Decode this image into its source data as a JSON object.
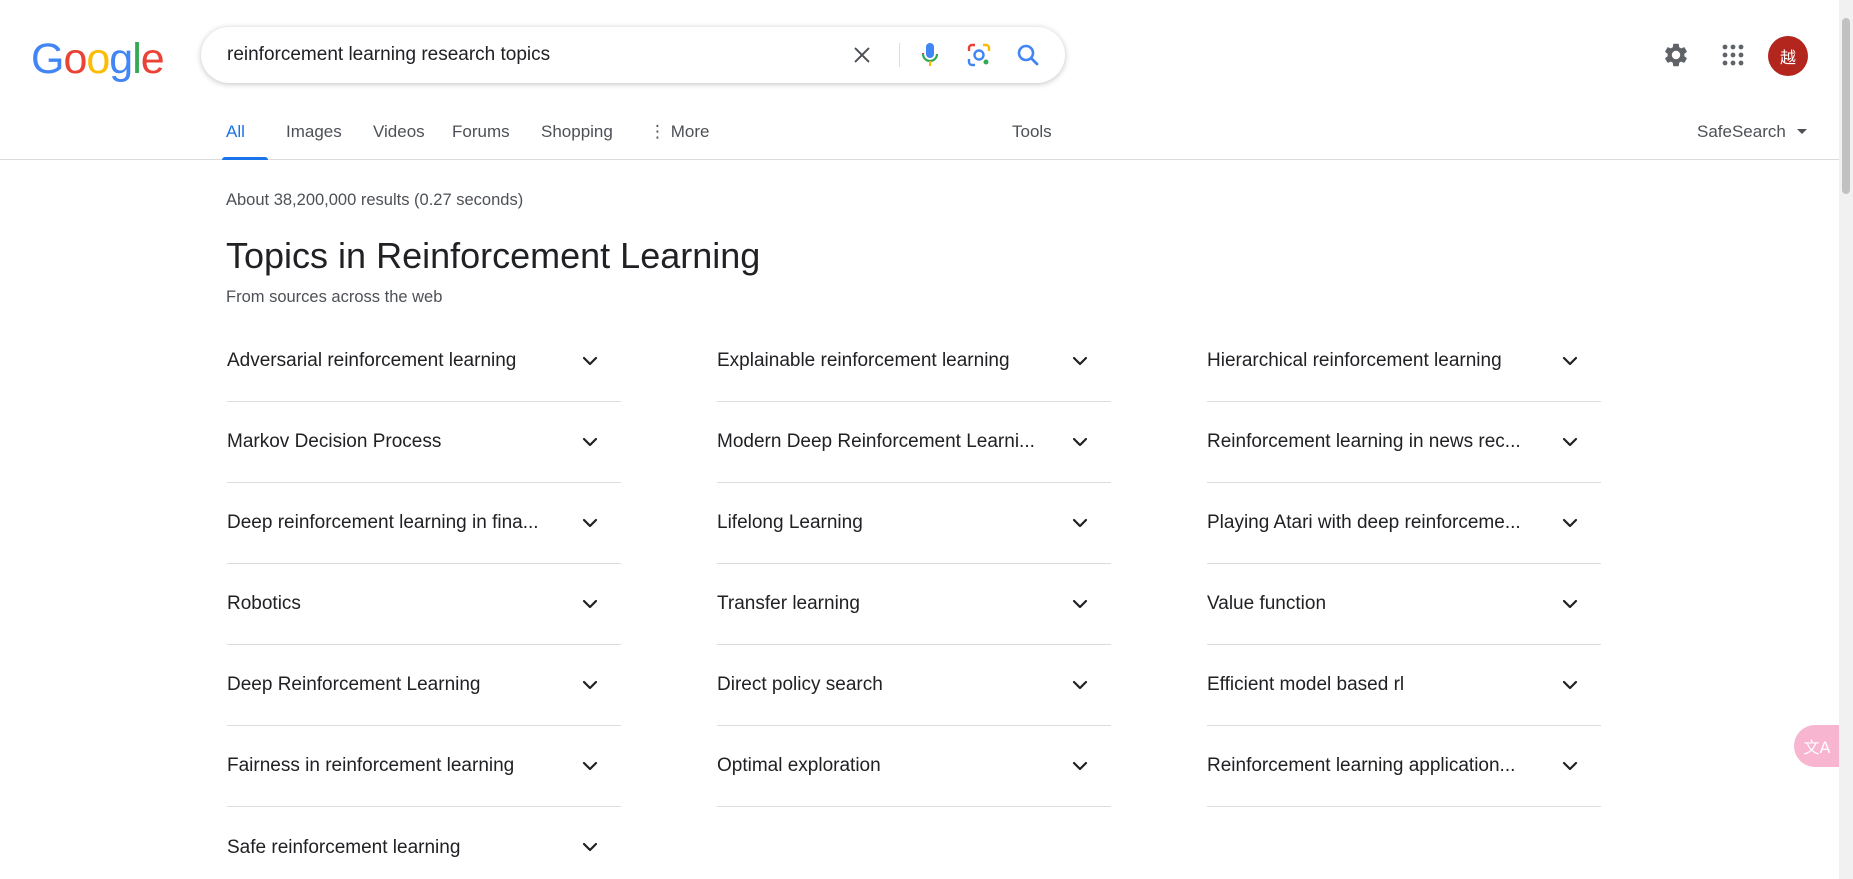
{
  "logo": {
    "letters": [
      {
        "ch": "G",
        "color": "#4285F4"
      },
      {
        "ch": "o",
        "color": "#EA4335"
      },
      {
        "ch": "o",
        "color": "#FBBC05"
      },
      {
        "ch": "g",
        "color": "#4285F4"
      },
      {
        "ch": "l",
        "color": "#34A853"
      },
      {
        "ch": "e",
        "color": "#EA4335"
      }
    ]
  },
  "search": {
    "query": "reinforcement learning research topics",
    "icons": [
      "clear-icon",
      "microphone-icon",
      "lens-icon",
      "search-icon"
    ]
  },
  "header": {
    "settings_icon": "gear-icon",
    "apps_icon": "apps-grid-icon",
    "avatar_text": "越"
  },
  "tabs": {
    "items": [
      {
        "label": "All",
        "active": true
      },
      {
        "label": "Images",
        "active": false
      },
      {
        "label": "Videos",
        "active": false
      },
      {
        "label": "Forums",
        "active": false
      },
      {
        "label": "Shopping",
        "active": false
      },
      {
        "label": "More",
        "active": false
      }
    ],
    "tools_label": "Tools",
    "safesearch_label": "SafeSearch"
  },
  "results": {
    "stats": "About 38,200,000 results (0.27 seconds)"
  },
  "topics_section": {
    "title": "Topics in Reinforcement Learning",
    "subtitle": "From sources across the web",
    "columns": [
      [
        "Adversarial reinforcement learning",
        "Markov Decision Process",
        "Deep reinforcement learning in fina...",
        "Robotics",
        "Deep Reinforcement Learning",
        "Fairness in reinforcement learning",
        "Safe reinforcement learning"
      ],
      [
        "Explainable reinforcement learning",
        "Modern Deep Reinforcement Learni...",
        "Lifelong Learning",
        "Transfer learning",
        "Direct policy search",
        "Optimal exploration"
      ],
      [
        "Hierarchical reinforcement learning",
        "Reinforcement learning in news rec...",
        "Playing Atari with deep reinforceme...",
        "Value function",
        "Efficient model based rl",
        "Reinforcement learning application..."
      ]
    ]
  },
  "colors": {
    "accent": "#1a73e8",
    "avatar_bg": "#b3261e",
    "divider": "#dadce0"
  }
}
